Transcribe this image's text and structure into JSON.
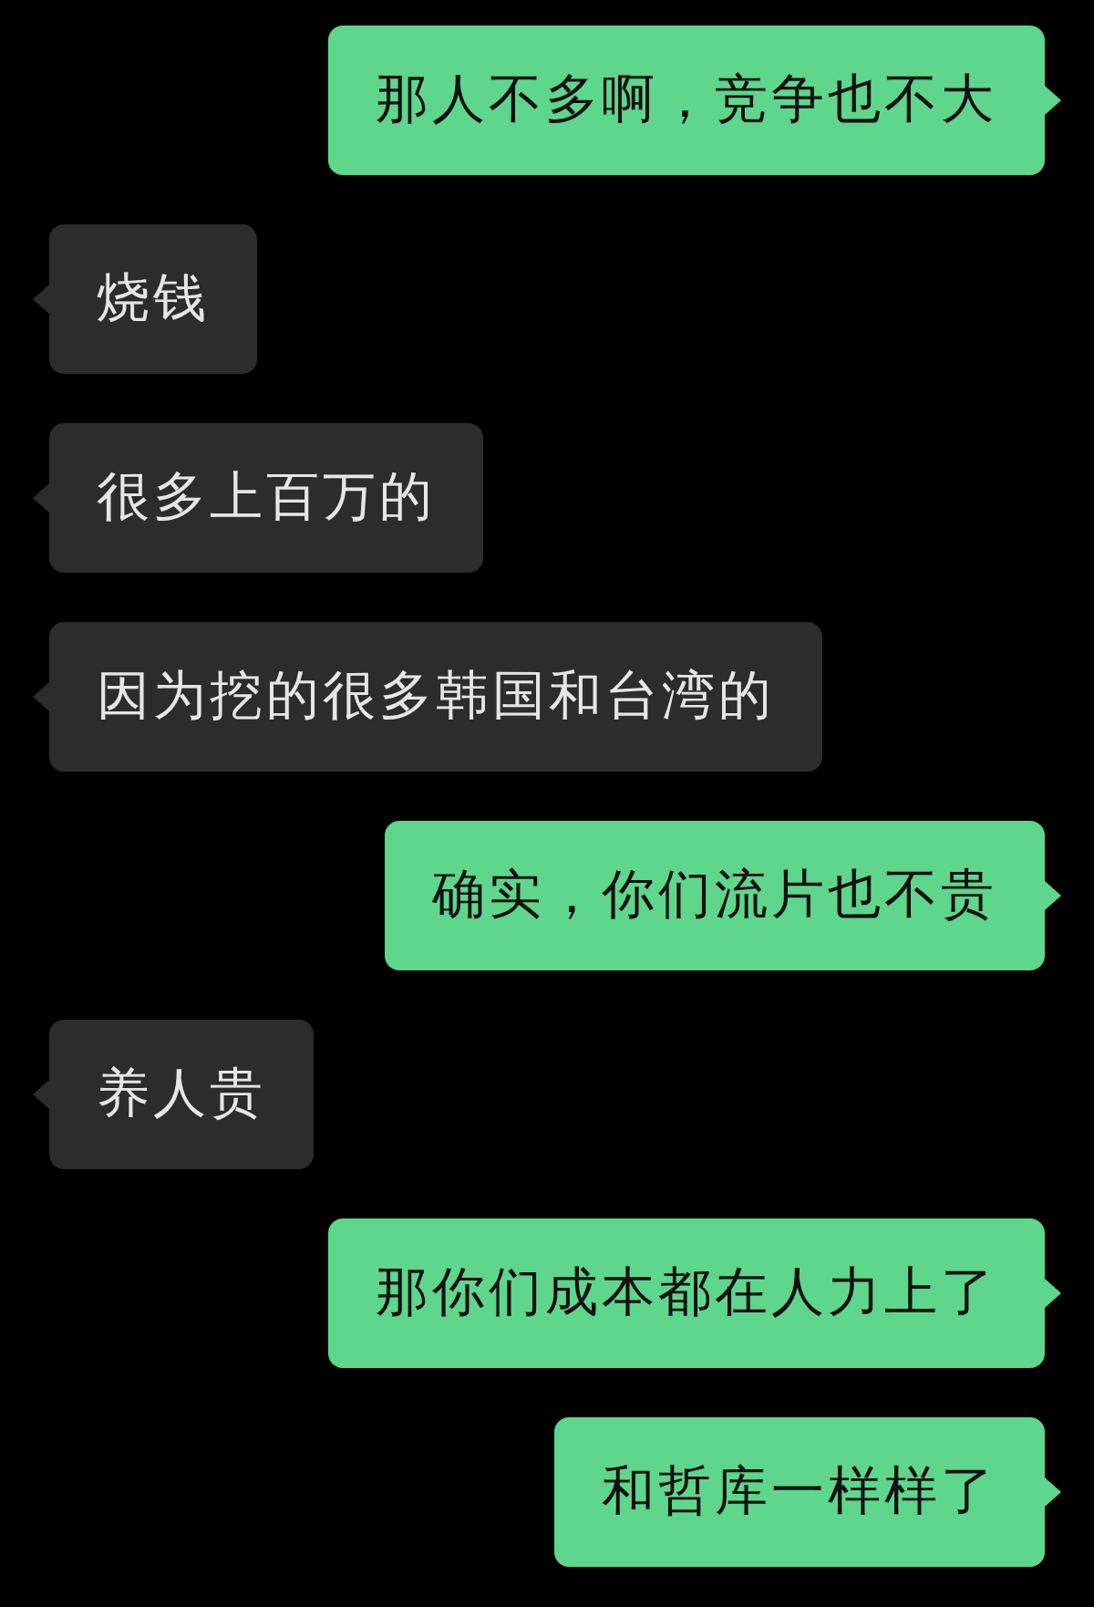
{
  "messages": [
    {
      "kind": "sent",
      "text": "那人不多啊，竞争也不大"
    },
    {
      "kind": "received",
      "text": "烧钱"
    },
    {
      "kind": "received",
      "text": "很多上百万的"
    },
    {
      "kind": "received",
      "text": "因为挖的很多韩国和台湾的"
    },
    {
      "kind": "sent",
      "text": "确实，你们流片也不贵"
    },
    {
      "kind": "received",
      "text": "养人贵"
    },
    {
      "kind": "sent",
      "text": "那你们成本都在人力上了"
    },
    {
      "kind": "sent",
      "text": "和哲库一样样了"
    }
  ]
}
